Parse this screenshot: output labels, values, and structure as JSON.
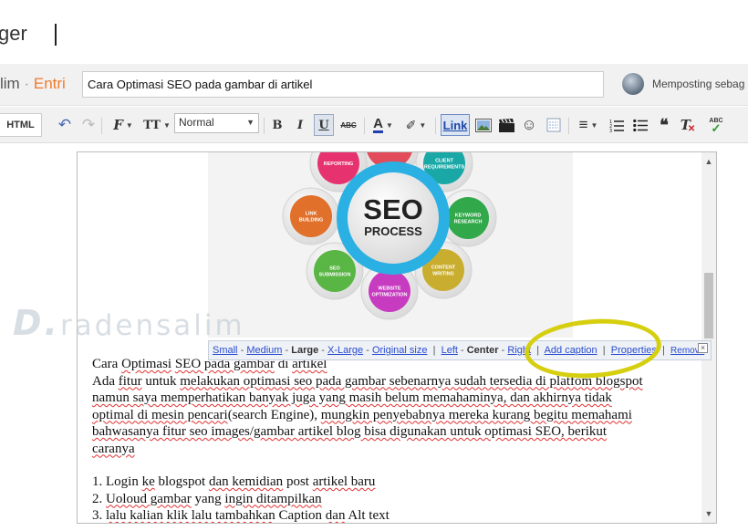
{
  "header": {
    "brand": "ger"
  },
  "titlebar": {
    "blog_name": "lim",
    "separator": "·",
    "section": "Entri",
    "post_title": "Cara Optimasi SEO pada gambar di artikel",
    "posting_as": "Memposting sebag"
  },
  "toolbar": {
    "html_label": "HTML",
    "font_label": "Normal",
    "link_label": "Link",
    "items": [
      {
        "name": "undo-icon",
        "glyph": "↶"
      },
      {
        "name": "redo-icon",
        "glyph": "↷"
      },
      {
        "name": "font-icon",
        "glyph": "F"
      },
      {
        "name": "text-size-icon",
        "glyph": "TT"
      },
      {
        "name": "bold-icon",
        "glyph": "B"
      },
      {
        "name": "italic-icon",
        "glyph": "I"
      },
      {
        "name": "underline-icon",
        "glyph": "U"
      },
      {
        "name": "strikethrough-icon",
        "glyph": "ABC"
      },
      {
        "name": "text-color-icon",
        "glyph": "A"
      },
      {
        "name": "highlight-icon",
        "glyph": "✐"
      },
      {
        "name": "image-icon",
        "glyph": "▣"
      },
      {
        "name": "video-icon",
        "glyph": "▬"
      },
      {
        "name": "emoji-icon",
        "glyph": "☺"
      },
      {
        "name": "jump-break-icon",
        "glyph": "⊟"
      },
      {
        "name": "align-icon",
        "glyph": "≡"
      },
      {
        "name": "numbered-list-icon",
        "glyph": "⒈"
      },
      {
        "name": "bullet-list-icon",
        "glyph": "•"
      },
      {
        "name": "quote-icon",
        "glyph": "❝"
      },
      {
        "name": "clear-format-icon",
        "glyph": "T"
      },
      {
        "name": "spellcheck-icon",
        "glyph": "✓"
      }
    ]
  },
  "image": {
    "center_title": "SEO",
    "center_subtitle": "PROCESS",
    "nodes": [
      {
        "label": "REPORTING",
        "color": "#e6336f"
      },
      {
        "label": "CLIENT REQUIREMENTS",
        "color": "#1aa8a7"
      },
      {
        "label": "LINK BUILDING",
        "color": "#e0702a"
      },
      {
        "label": "KEYWORD RESEARCH",
        "color": "#31a84a"
      },
      {
        "label": "SEO SUBMISSION",
        "color": "#59b544"
      },
      {
        "label": "CONTENT WRITING",
        "color": "#c8ad2e"
      },
      {
        "label": "WEBSITE OPTIMIZATION",
        "color": "#c73bc0"
      }
    ],
    "ring_color": "#2bb0e3",
    "watermark": "radensalim",
    "watermark_letter": "D."
  },
  "image_toolbar": {
    "small": "Small",
    "medium": "Medium",
    "large": "Large",
    "xlarge": "X-Large",
    "original": "Original size",
    "left": "Left",
    "center": "Center",
    "right": "Right",
    "add_caption": "Add caption",
    "properties": "Properties",
    "remove": "Remove",
    "close": "×",
    "dash": "-",
    "bar": "|"
  },
  "body": {
    "l1a": "Cara ",
    "l1b": "Optimasi",
    "l1c": " ",
    "l1d": "SEO pada gambar",
    "l1e": " di ",
    "l1f": "artikel",
    "l2a": "Ada ",
    "l2b": "fitur",
    "l2c": " untuk ",
    "l2d": "melakukan optimasi seo pada gambar sebenarnya sudah tersedia di platfom blogspot",
    "l3": "namun saya memperhatikan banyak juga yang masih belum memahaminya, dan akhirnya tidak",
    "l4a": "optimal di mesin pencari",
    "l4b": "(search Engine), ",
    "l4c": "mungkin penyebabnya mereka kurang begitu memahami",
    "l5": "bahwasanya fitur seo images/gambar artikel blog bisa digunakan untuk optimasi SEO, berikut",
    "l6": "caranya",
    "step1a": "1. Login ",
    "step1b": "ke",
    "step1c": " blogspot ",
    "step1d": "dan kemidian",
    "step1e": " post ",
    "step1f": "artikel baru",
    "step2a": "2. ",
    "step2b": "Uoloud gambar",
    "step2c": " yang ",
    "step2d": "ingin ditampilkan",
    "step3a": "3. ",
    "step3b": "lalu kalian klik lalu tambahkan",
    "step3c": " Caption ",
    "step3d": "dan",
    "step3e": " Alt text"
  },
  "scrollbar": {
    "up": "▲",
    "down": "▼"
  }
}
